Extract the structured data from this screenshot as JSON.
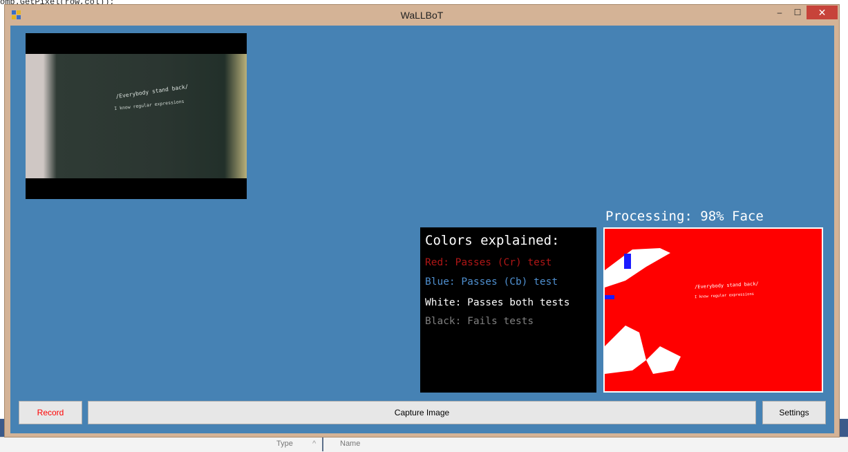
{
  "background": {
    "code_line": "omp.GetPixel(row,col));",
    "columns": {
      "type_label": "Type",
      "name_label": "Name"
    }
  },
  "window": {
    "title": "WaLLBoT",
    "controls": {
      "minimize": "–",
      "maximize": "☐",
      "close": "✕"
    }
  },
  "webcam": {
    "shirt_line1": "/Everybody stand back/",
    "shirt_line2": "I know regular expressions"
  },
  "processing": {
    "label": "Processing: 98% Face",
    "percent": 98
  },
  "legend": {
    "heading": "Colors explained:",
    "items": [
      {
        "text": "Red: Passes (Cr) test",
        "color": "#b01616"
      },
      {
        "text": "Blue: Passes (Cb) test",
        "color": "#4f8fcf"
      },
      {
        "text": "White: Passes both tests",
        "color": "#ffffff"
      },
      {
        "text": "Black: Fails tests",
        "color": "#808080"
      }
    ]
  },
  "processed_view": {
    "line1": "/Everybody stand back/",
    "line2": "I know regular expressions"
  },
  "buttons": {
    "record": "Record",
    "capture": "Capture Image",
    "settings": "Settings"
  },
  "colors": {
    "client_background": "#4682b4",
    "frame": "#d4b396",
    "mask_red": "#ff0000",
    "close_button": "#c7433a"
  }
}
